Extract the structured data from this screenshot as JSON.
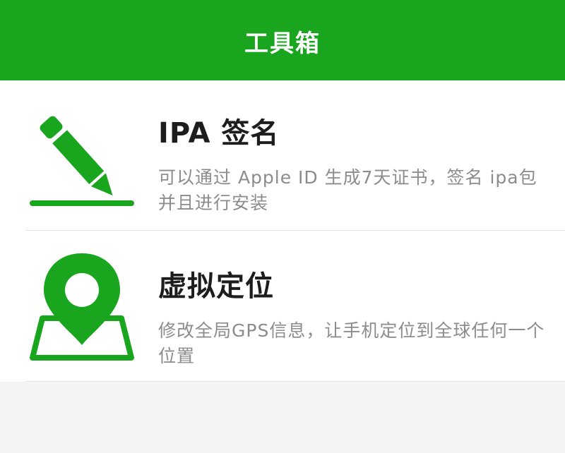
{
  "header": {
    "title": "工具箱"
  },
  "colors": {
    "brand_green": "#1aa51f",
    "title_text": "#1d1d1d",
    "desc_text": "#8c8c8c"
  },
  "tools": [
    {
      "icon": "pencil-icon",
      "title": "IPA 签名",
      "description": "可以通过 Apple ID 生成7天证书，签名 ipa包并且进行安装"
    },
    {
      "icon": "location-pin-icon",
      "title": "虚拟定位",
      "description": "修改全局GPS信息，让手机定位到全球任何一个位置"
    }
  ]
}
